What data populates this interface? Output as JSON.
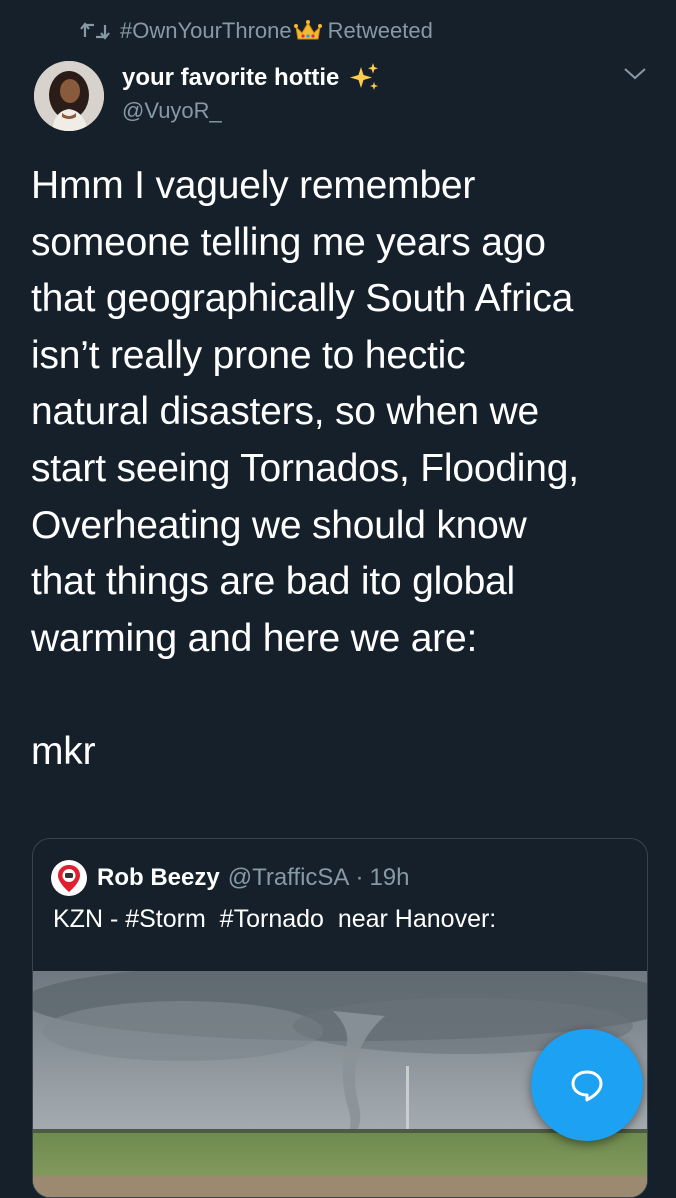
{
  "retweet_bar": {
    "hashtag_prefix": "#OwnYourThrone",
    "status": "Retweeted"
  },
  "author": {
    "display_name": "your favorite hottie",
    "handle": "@VuyoR_"
  },
  "tweet": {
    "text": "Hmm I vaguely remember\nsomeone telling me years ago\nthat geographically South Africa\nisn’t really prone to hectic\nnatural disasters, so when we\nstart seeing Tornados, Flooding,\nOverheating we should know\nthat things are bad ito global\nwarming and here we are:\n\nmkr"
  },
  "quoted_tweet": {
    "display_name": "Rob Beezy",
    "handle": "@TrafficSA",
    "separator": "·",
    "time": "19h",
    "text": "KZN - #Storm  #Tornado  near Hanover:"
  },
  "icons": {
    "retweet": "retweet-icon",
    "crown": "crown-emoji-icon",
    "sparkles": "sparkles-emoji-icon",
    "more": "chevron-down-icon",
    "compose_reply": "reply-bubble-icon"
  },
  "colors": {
    "background": "#15202b",
    "secondary_text": "#8899a6",
    "accent": "#1da1f2",
    "border": "#38444d"
  }
}
